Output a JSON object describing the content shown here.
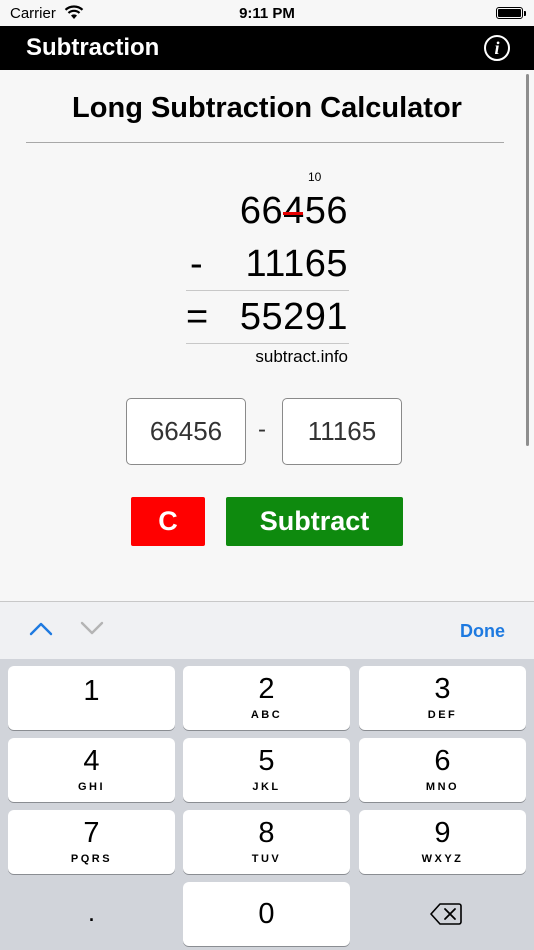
{
  "status_bar": {
    "carrier": "Carrier",
    "time": "9:11 PM"
  },
  "navbar": {
    "title": "Subtraction",
    "info_icon": "i"
  },
  "heading": "Long Subtraction Calculator",
  "display": {
    "borrow": "10",
    "minuend": "66456",
    "minus": "-",
    "subtrahend": "11165",
    "equals": "=",
    "result": "55291",
    "site": "subtract.info",
    "strike_color": "#e60000"
  },
  "inputs": {
    "first": "66456",
    "operator": "-",
    "second": "11165"
  },
  "buttons": {
    "clear": "C",
    "subtract": "Subtract",
    "clear_color": "#ff0000",
    "subtract_color": "#0e8a0e"
  },
  "accessory": {
    "done": "Done",
    "up_icon": "chevron-up",
    "down_icon": "chevron-down"
  },
  "keypad": {
    "keys": [
      {
        "digit": "1",
        "letters": ""
      },
      {
        "digit": "2",
        "letters": "ABC"
      },
      {
        "digit": "3",
        "letters": "DEF"
      },
      {
        "digit": "4",
        "letters": "GHI"
      },
      {
        "digit": "5",
        "letters": "JKL"
      },
      {
        "digit": "6",
        "letters": "MNO"
      },
      {
        "digit": "7",
        "letters": "PQRS"
      },
      {
        "digit": "8",
        "letters": "TUV"
      },
      {
        "digit": "9",
        "letters": "WXYZ"
      }
    ],
    "dot": ".",
    "zero": "0"
  }
}
